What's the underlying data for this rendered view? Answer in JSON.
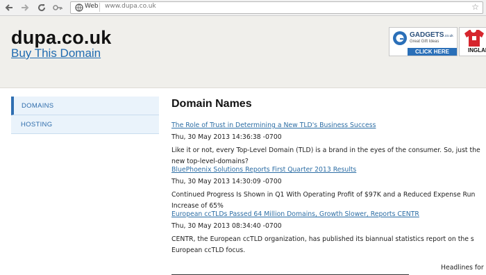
{
  "browser": {
    "scheme_label": "Web",
    "url": "www.dupa.co.uk"
  },
  "header": {
    "site_title": "dupa.co.uk",
    "buy_link": "Buy This Domain"
  },
  "ads": [
    {
      "brand": "GADGETS",
      "suffix": ".co.uk",
      "tagline": "Great Gift Ideas",
      "cta": "CLICK HERE"
    },
    {
      "label": "INGLAN"
    }
  ],
  "sidebar": {
    "items": [
      {
        "label": "DOMAINS"
      },
      {
        "label": "HOSTING"
      }
    ]
  },
  "main": {
    "title": "Domain Names",
    "articles": [
      {
        "title": "The Role of Trust in Determining a New TLD's Business Success",
        "date": "Thu, 30 May 2013 14:36:38 -0700",
        "description": "Like it or not, every Top-Level Domain (TLD) is a brand in the eyes of the consumer. So, just the new top-level-domains?"
      },
      {
        "title": "BluePhoenix Solutions Reports First Quarter 2013 Results",
        "date": "Thu, 30 May 2013 14:30:09 -0700",
        "description": "Continued Progress Is Shown in Q1 With Operating Profit of $97K and a Reduced Expense Run Increase of 65%"
      },
      {
        "title": "European ccTLDs Passed 64 Million Domains, Growth Slower, Reports CENTR",
        "date": "Thu, 30 May 2013 08:34:40 -0700",
        "description": "CENTR, the European ccTLD organization, has published its biannual statistics report on the s European ccTLD focus."
      }
    ],
    "headlines_label": "Headlines for"
  },
  "colors": {
    "link": "#2d6ea5",
    "sidebar_bg": "#eaf3fb",
    "sidebar_accent": "#2f6fb2",
    "header_bg": "#f0efeb"
  }
}
